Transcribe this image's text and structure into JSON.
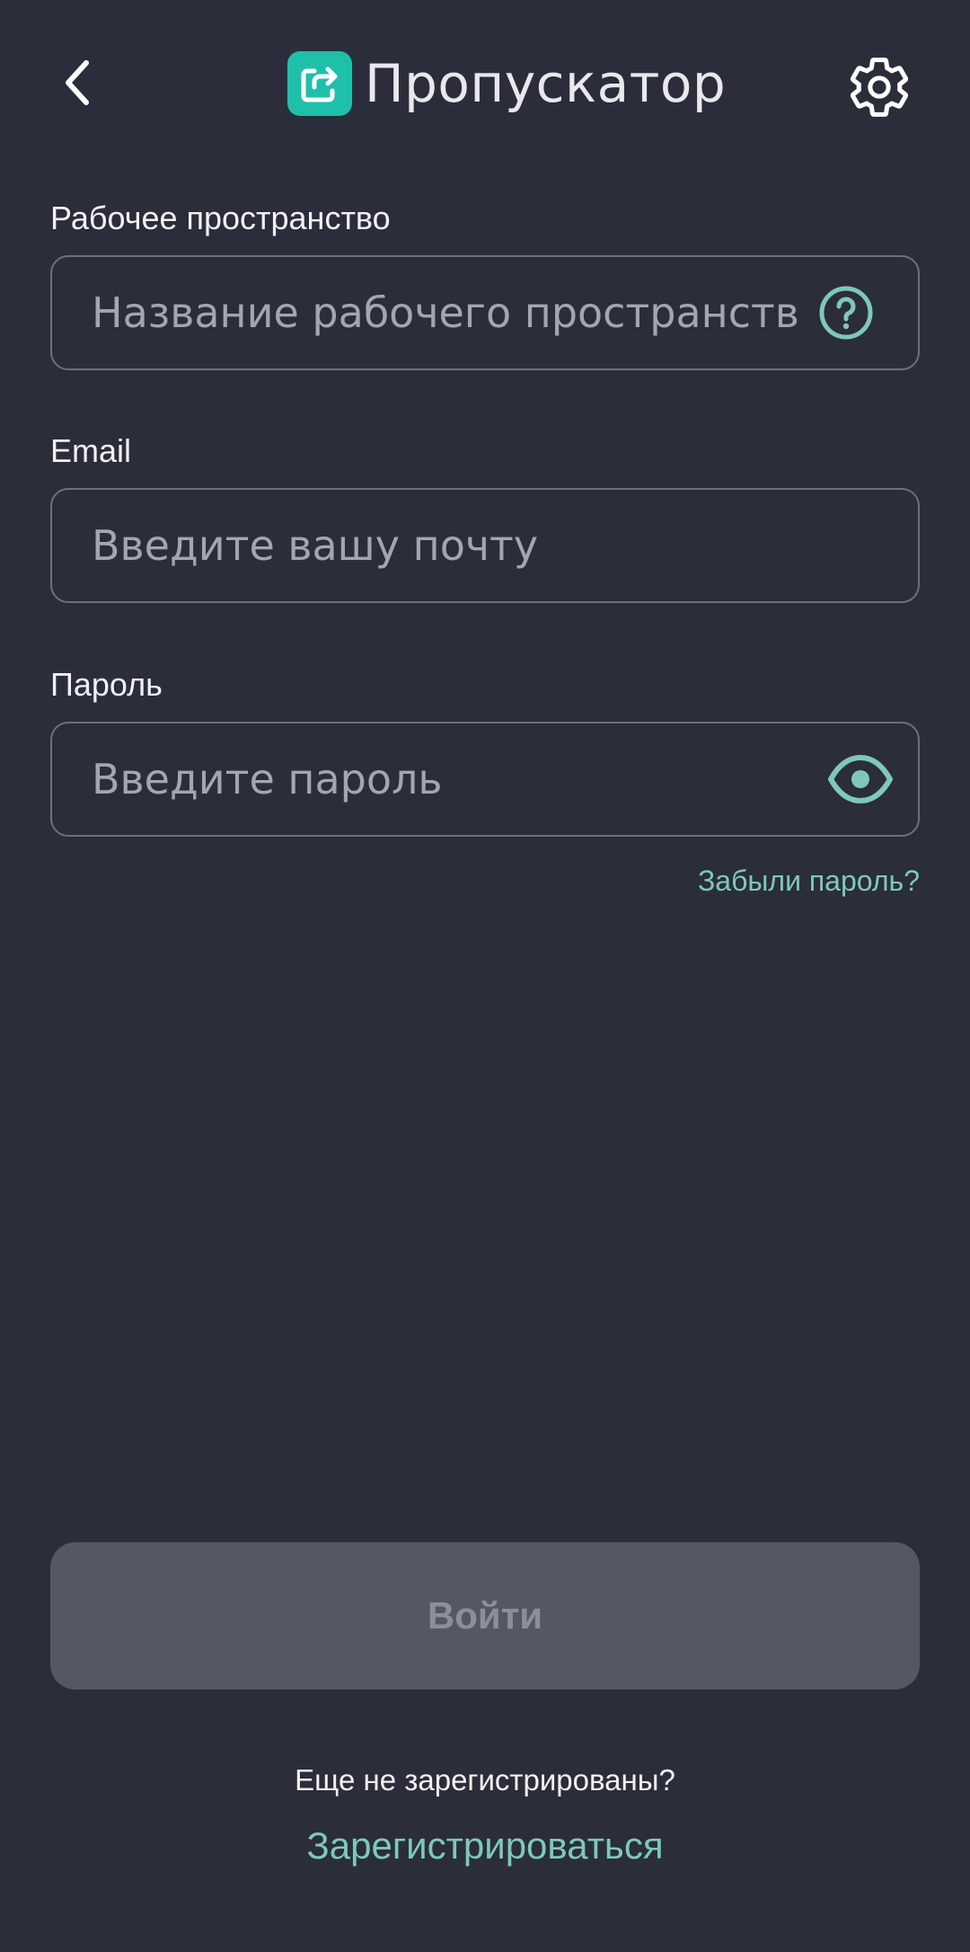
{
  "header": {
    "app_name": "Пропускатор",
    "back_icon": "chevron-left-icon",
    "settings_icon": "gear-icon",
    "logo_icon": "exit-arrow-logo-icon"
  },
  "form": {
    "workspace": {
      "label": "Рабочее пространство",
      "placeholder": "Название рабочего пространств",
      "value": "",
      "icon": "help-circle-icon"
    },
    "email": {
      "label": "Email",
      "placeholder": "Введите вашу почту",
      "value": ""
    },
    "password": {
      "label": "Пароль",
      "placeholder": "Введите пароль",
      "value": "",
      "icon": "eye-icon"
    },
    "forgot_password": "Забыли пароль?"
  },
  "login_button": "Войти",
  "footer": {
    "register_prompt": "Еще не зарегистрированы?",
    "register_link": "Зарегистрироваться"
  },
  "colors": {
    "background": "#2b2d3a",
    "accent": "#1fc0aa",
    "link": "#7ec8bb",
    "button_disabled": "#555763"
  }
}
